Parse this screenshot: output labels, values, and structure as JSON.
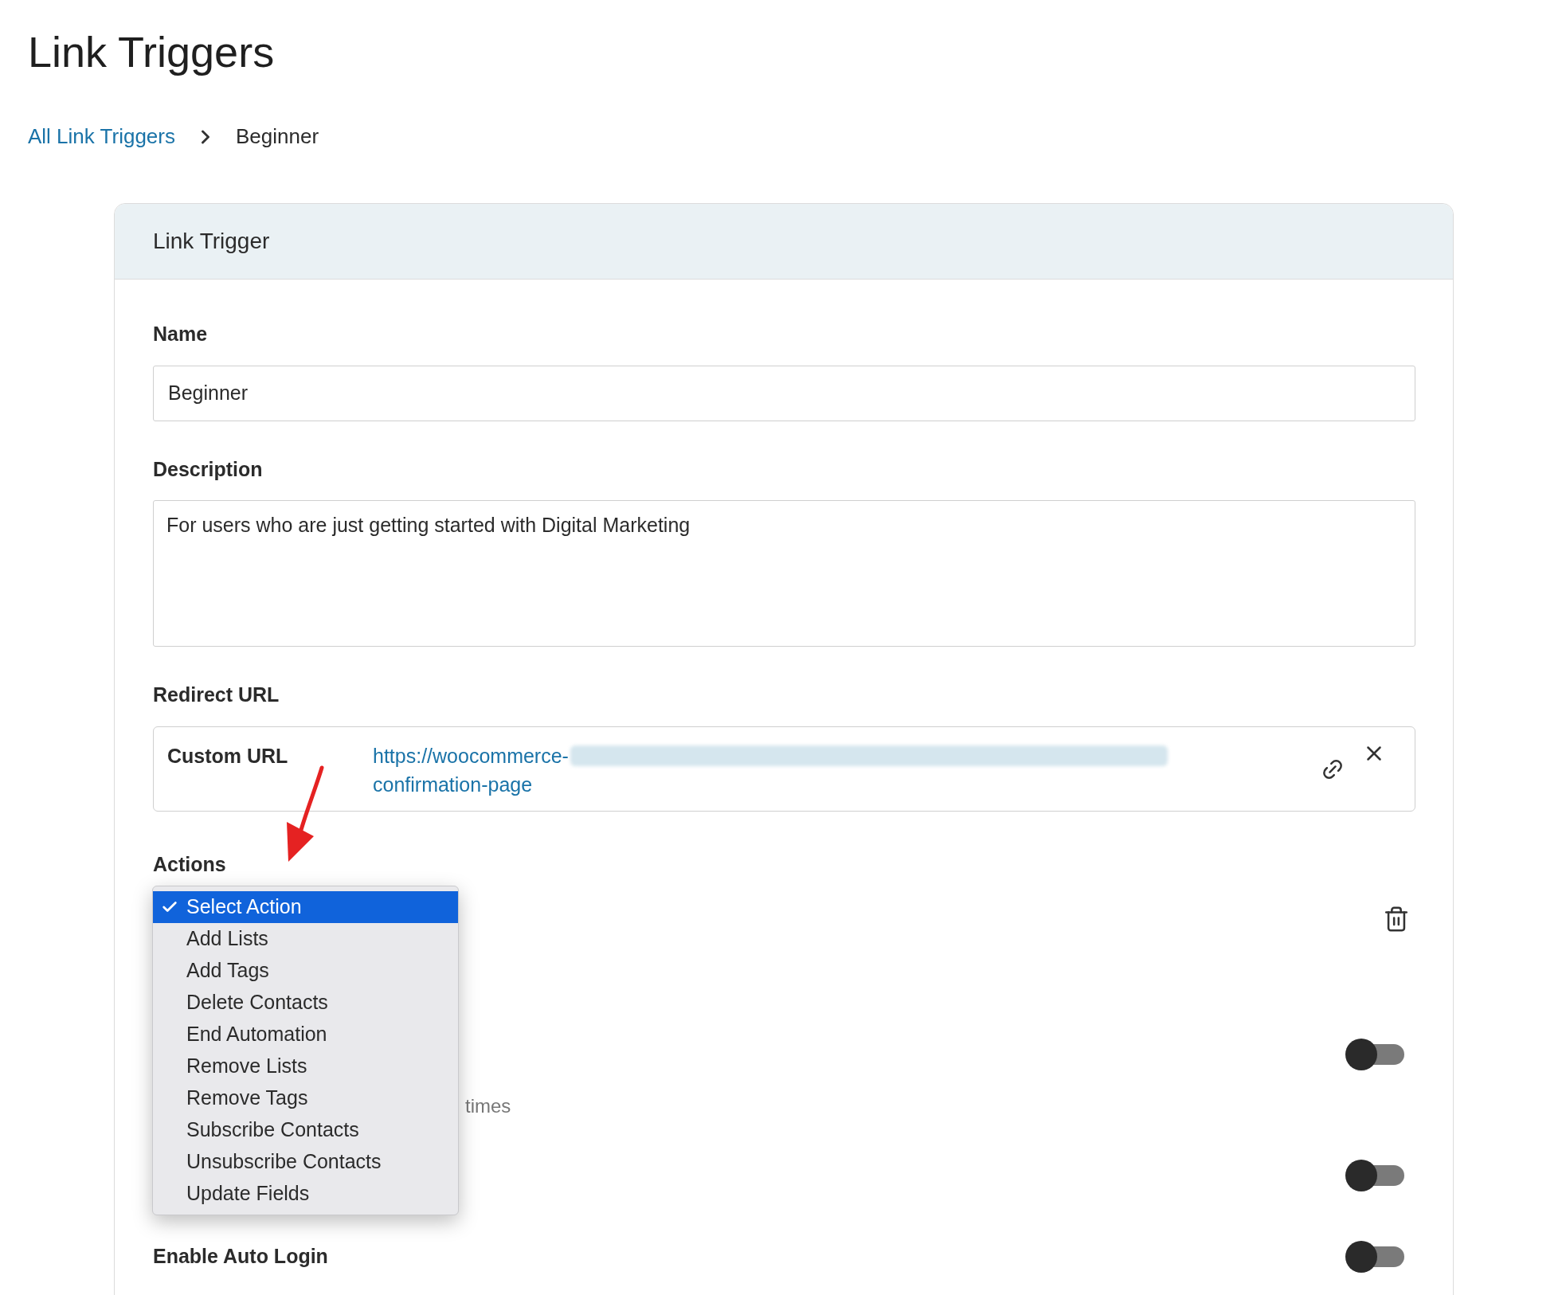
{
  "page": {
    "title": "Link Triggers"
  },
  "breadcrumb": [
    {
      "label": "All Link Triggers",
      "kind": "link"
    },
    {
      "label": "Beginner",
      "kind": "current"
    }
  ],
  "card": {
    "title": "Link Trigger"
  },
  "name_field": {
    "label": "Name",
    "value": "Beginner"
  },
  "description_field": {
    "label": "Description",
    "value": "For users who are just getting started with Digital Marketing"
  },
  "redirect": {
    "label": "Redirect URL",
    "type_label": "Custom URL",
    "url_lines": [
      "https://woocommerce-",
      "confirmation-page"
    ]
  },
  "actions": {
    "label": "Actions",
    "menu": [
      {
        "label": "Select Action",
        "selected": true
      },
      {
        "label": "Add Lists",
        "selected": false
      },
      {
        "label": "Add Tags",
        "selected": false
      },
      {
        "label": "Delete Contacts",
        "selected": false
      },
      {
        "label": "End Automation",
        "selected": false
      },
      {
        "label": "Remove Lists",
        "selected": false
      },
      {
        "label": "Remove Tags",
        "selected": false
      },
      {
        "label": "Subscribe Contacts",
        "selected": false
      },
      {
        "label": "Unsubscribe Contacts",
        "selected": false
      },
      {
        "label": "Update Fields",
        "selected": false
      }
    ]
  },
  "settings": [
    {
      "on": false
    },
    {
      "note": "times"
    },
    {
      "on": false
    },
    {
      "label": "Enable Auto Login",
      "on": false
    }
  ]
}
